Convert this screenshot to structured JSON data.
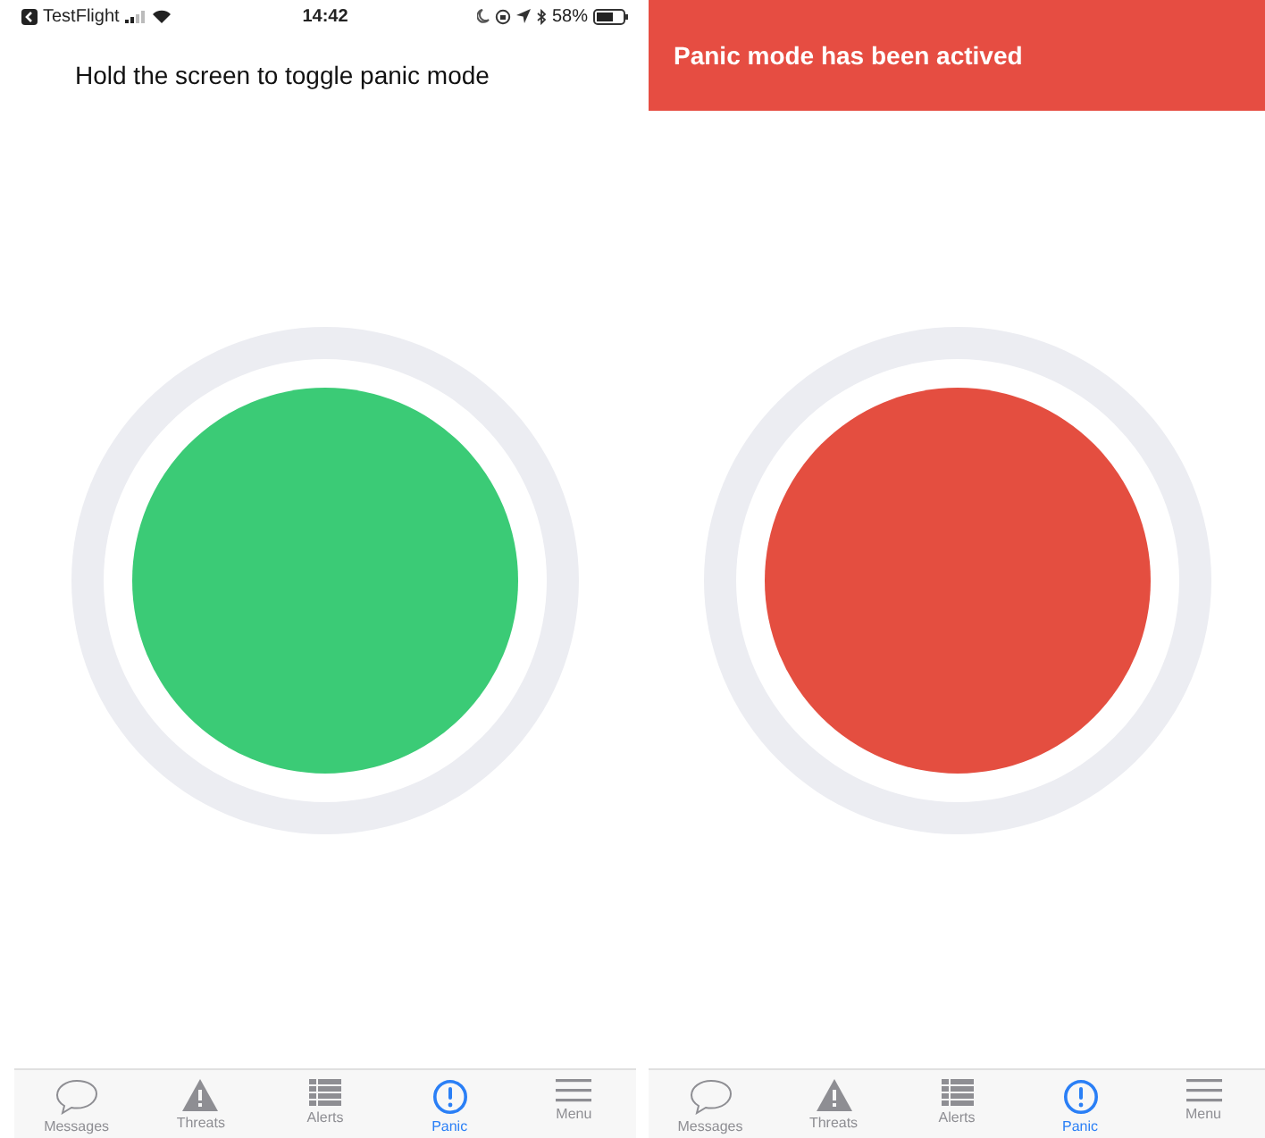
{
  "screens": [
    {
      "panic_active": false,
      "status_bar": {
        "app": "TestFlight",
        "time": "14:42",
        "battery": "58%"
      },
      "hint": "Hold the screen to toggle panic mode",
      "tabs": [
        {
          "label": "Messages",
          "selected": false
        },
        {
          "label": "Threats",
          "selected": false
        },
        {
          "label": "Alerts",
          "selected": false
        },
        {
          "label": "Panic",
          "selected": true
        },
        {
          "label": "Menu",
          "selected": false
        }
      ]
    },
    {
      "panic_active": true,
      "banner": "Panic mode has been actived",
      "tabs": [
        {
          "label": "Messages",
          "selected": false
        },
        {
          "label": "Threats",
          "selected": false
        },
        {
          "label": "Alerts",
          "selected": false
        },
        {
          "label": "Panic",
          "selected": true
        },
        {
          "label": "Menu",
          "selected": false
        }
      ]
    }
  ]
}
